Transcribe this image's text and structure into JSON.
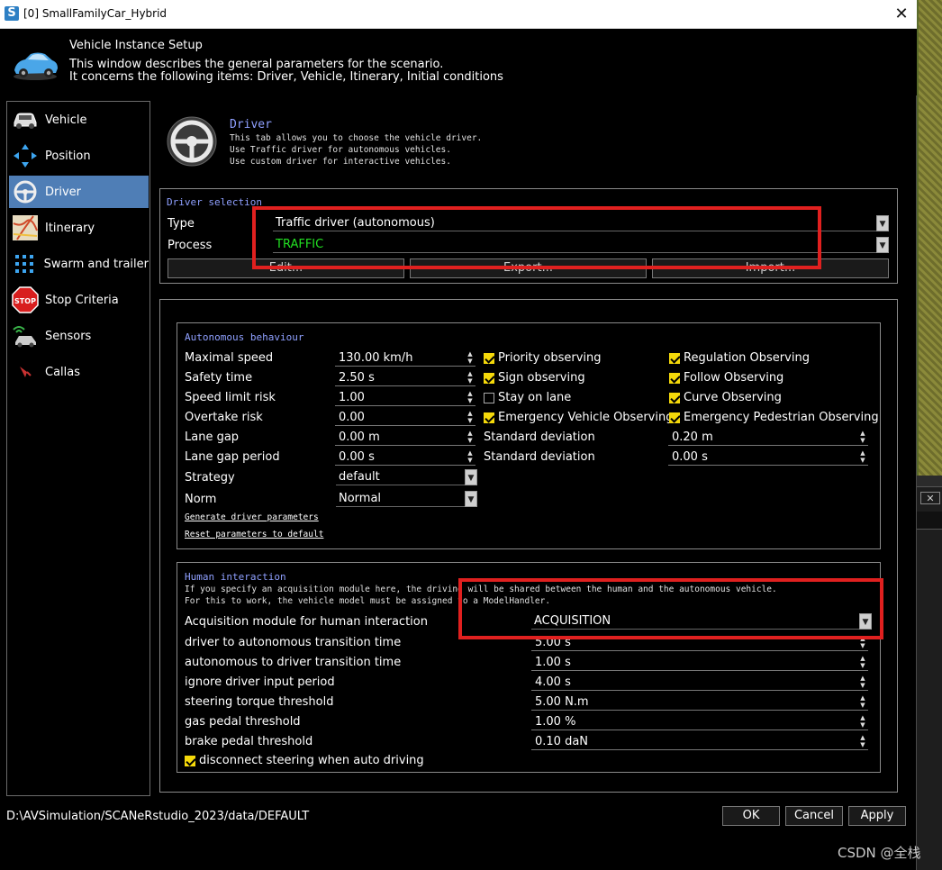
{
  "window": {
    "title": "[0] SmallFamilyCar_Hybrid",
    "icon_letter": "S",
    "close_glyph": "✕"
  },
  "header": {
    "title": "Vehicle Instance Setup",
    "line1": "This window describes the general parameters for the scenario.",
    "line2": "It concerns the following items: Driver, Vehicle, Itinerary, Initial conditions"
  },
  "sidebar": {
    "items": [
      {
        "label": "Vehicle",
        "icon": "vehicle-icon"
      },
      {
        "label": "Position",
        "icon": "position-arrows-icon"
      },
      {
        "label": "Driver",
        "icon": "steering-wheel-icon",
        "active": true
      },
      {
        "label": "Itinerary",
        "icon": "map-icon"
      },
      {
        "label": "Swarm and trailer",
        "icon": "swarm-icon"
      },
      {
        "label": "Stop Criteria",
        "icon": "stop-sign-icon"
      },
      {
        "label": "Sensors",
        "icon": "sensor-icon"
      },
      {
        "label": "Callas",
        "icon": "callas-icon"
      }
    ]
  },
  "driver_tab": {
    "title": "Driver",
    "desc1": "This tab allows you to choose the vehicle driver.",
    "desc2": "Use Traffic driver for autonomous vehicles.",
    "desc3": "Use custom driver for interactive vehicles."
  },
  "driver_selection": {
    "title": "Driver selection",
    "type_label": "Type",
    "type_value": "Traffic driver (autonomous)",
    "process_label": "Process",
    "process_value": "TRAFFIC",
    "edit_btn": "Edit...",
    "export_btn": "Export...",
    "import_btn": "Import..."
  },
  "autonomous": {
    "title": "Autonomous behaviour",
    "fields": [
      {
        "label": "Maximal speed",
        "value": "130.00 km/h"
      },
      {
        "label": "Safety time",
        "value": "2.50 s"
      },
      {
        "label": "Speed limit risk",
        "value": "1.00"
      },
      {
        "label": "Overtake risk",
        "value": "0.00"
      },
      {
        "label": "Lane gap",
        "value": "0.00 m"
      },
      {
        "label": "Lane gap period",
        "value": "0.00 s"
      }
    ],
    "strategy_label": "Strategy",
    "strategy_value": "default",
    "norm_label": "Norm",
    "norm_value": "Normal",
    "checks_col1": [
      {
        "label": "Priority observing",
        "checked": true
      },
      {
        "label": "Sign observing",
        "checked": true
      },
      {
        "label": "Stay on lane",
        "checked": false
      },
      {
        "label": "Emergency Vehicle Observing",
        "checked": true
      }
    ],
    "checks_col2": [
      {
        "label": "Regulation Observing",
        "checked": true
      },
      {
        "label": "Follow Observing",
        "checked": true
      },
      {
        "label": "Curve Observing",
        "checked": true
      },
      {
        "label": "Emergency Pedestrian Observing",
        "checked": true
      }
    ],
    "std_dev_label1": "Standard deviation",
    "std_dev_value1": "0.20 m",
    "std_dev_label2": "Standard deviation",
    "std_dev_value2": "0.00 s",
    "link_generate": "Generate driver parameters",
    "link_reset": "Reset parameters to default"
  },
  "human": {
    "title": "Human interaction",
    "note1": "If you specify an acquisition module here, the driving will be shared between the human and the autonomous vehicle.",
    "note2": "For this to work, the vehicle model must be assigned to a ModelHandler.",
    "acq_label": "Acquisition module for human interaction",
    "acq_value": "ACQUISITION",
    "fields": [
      {
        "label": "driver to autonomous transition time",
        "value": "5.00 s"
      },
      {
        "label": "autonomous to driver transition time",
        "value": "1.00 s"
      },
      {
        "label": "ignore driver input period",
        "value": "4.00 s"
      },
      {
        "label": "steering torque threshold",
        "value": "5.00 N.m"
      },
      {
        "label": "gas pedal threshold",
        "value": "1.00 %"
      },
      {
        "label": "brake pedal threshold",
        "value": "0.10 daN"
      }
    ],
    "disconnect_label": "disconnect steering when auto driving",
    "disconnect_checked": true
  },
  "footer": {
    "path": "D:\\AVSimulation/SCANeRstudio_2023/data/DEFAULT",
    "ok": "OK",
    "cancel": "Cancel",
    "apply": "Apply"
  },
  "watermark": "CSDN @全栈",
  "colors": {
    "accent_title": "#8fa0ff",
    "selected_item": "#4f7eb6",
    "process_text": "#22e022",
    "check_yellow": "#f5d90a",
    "annotation_red": "#e0201f"
  }
}
